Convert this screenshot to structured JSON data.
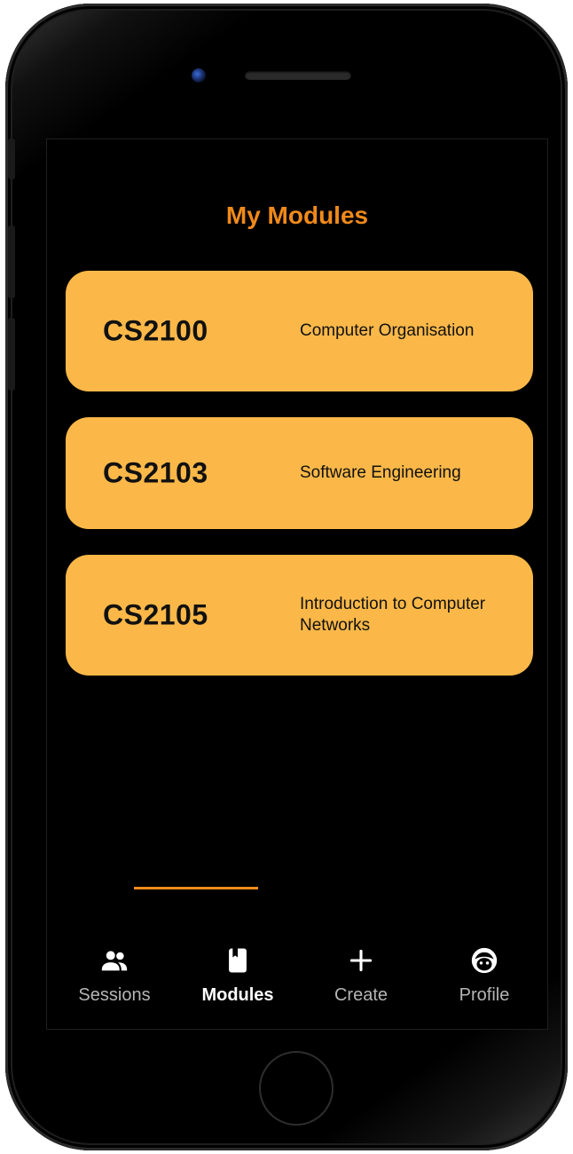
{
  "app": {
    "title": "My Modules",
    "accent_color": "#f08a1a",
    "card_color": "#fbb848"
  },
  "modules": [
    {
      "code": "CS2100",
      "name": "Computer Organisation"
    },
    {
      "code": "CS2103",
      "name": "Software Engineering"
    },
    {
      "code": "CS2105",
      "name": "Introduction to Computer Networks"
    }
  ],
  "tabs": [
    {
      "label": "Sessions",
      "icon": "people-icon",
      "active": false
    },
    {
      "label": "Modules",
      "icon": "book-icon",
      "active": true
    },
    {
      "label": "Create",
      "icon": "plus-icon",
      "active": false
    },
    {
      "label": "Profile",
      "icon": "face-icon",
      "active": false
    }
  ]
}
